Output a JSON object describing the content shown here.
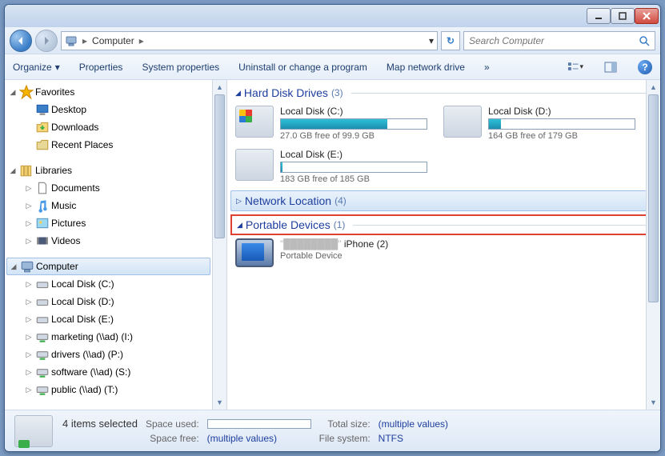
{
  "breadcrumb": {
    "location": "Computer"
  },
  "search": {
    "placeholder": "Search Computer"
  },
  "toolbar": {
    "organize": "Organize",
    "properties": "Properties",
    "system_properties": "System properties",
    "uninstall": "Uninstall or change a program",
    "map_drive": "Map network drive",
    "more": "»"
  },
  "sidebar": {
    "favorites": {
      "label": "Favorites",
      "items": [
        "Desktop",
        "Downloads",
        "Recent Places"
      ]
    },
    "libraries": {
      "label": "Libraries",
      "items": [
        "Documents",
        "Music",
        "Pictures",
        "Videos"
      ]
    },
    "computer": {
      "label": "Computer",
      "items": [
        "Local Disk (C:)",
        "Local Disk (D:)",
        "Local Disk (E:)",
        "marketing (\\\\ad) (I:)",
        "drivers (\\\\ad) (P:)",
        "software (\\\\ad) (S:)",
        "public (\\\\ad) (T:)"
      ]
    }
  },
  "groups": {
    "hdd": {
      "label": "Hard Disk Drives",
      "count": "(3)"
    },
    "net": {
      "label": "Network Location",
      "count": "(4)"
    },
    "portable": {
      "label": "Portable Devices",
      "count": "(1)"
    }
  },
  "drives": [
    {
      "name": "Local Disk (C:)",
      "free": "27.0 GB free of 99.9 GB",
      "fill": 73
    },
    {
      "name": "Local Disk (D:)",
      "free": "164 GB free of 179 GB",
      "fill": 8
    },
    {
      "name": "Local Disk (E:)",
      "free": "183 GB free of 185 GB",
      "fill": 1
    }
  ],
  "device": {
    "name": "iPhone (2)",
    "type": "Portable Device"
  },
  "status": {
    "selected": "4 items selected",
    "space_used_label": "Space used:",
    "space_free_label": "Space free:",
    "space_free_val": "(multiple values)",
    "total_size_label": "Total size:",
    "total_size_val": "(multiple values)",
    "fs_label": "File system:",
    "fs_val": "NTFS"
  }
}
